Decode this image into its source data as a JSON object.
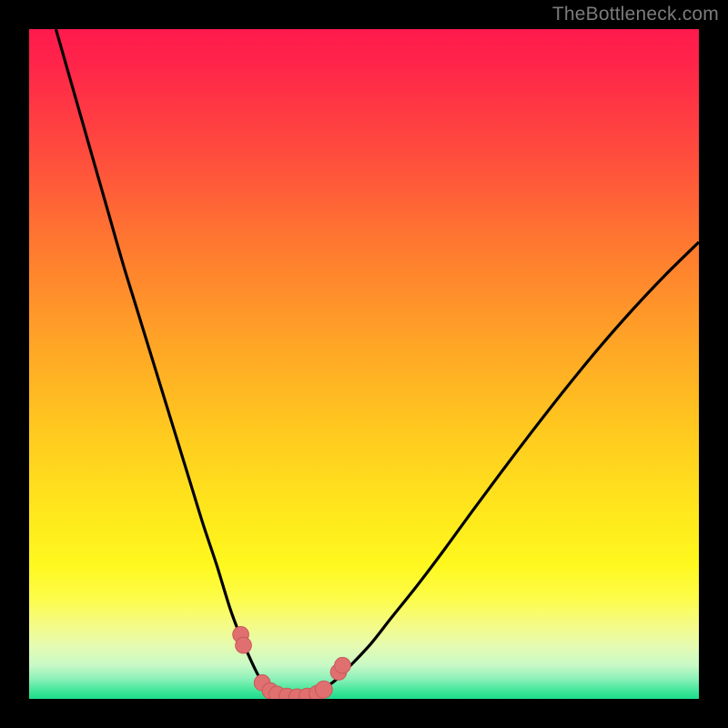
{
  "watermark": {
    "text": "TheBottleneck.com"
  },
  "chart_data": {
    "type": "line",
    "title": "",
    "xlabel": "",
    "ylabel": "",
    "xlim": [
      0,
      100
    ],
    "ylim": [
      0,
      100
    ],
    "gradient_note": "red (top) → yellow → green (bottom)",
    "curves": [
      {
        "name": "left-branch",
        "x": [
          4,
          6,
          8,
          10,
          12,
          14,
          16,
          18,
          20,
          22,
          24,
          26,
          28,
          30,
          31.5,
          33,
          34.5,
          36
        ],
        "y": [
          100,
          93,
          86,
          79,
          72,
          65,
          58.5,
          52,
          45.5,
          39,
          32.5,
          26,
          20,
          13.5,
          9.5,
          6,
          3,
          1.2
        ]
      },
      {
        "name": "valley",
        "x": [
          36,
          37,
          38,
          39,
          40,
          41,
          42,
          43,
          44
        ],
        "y": [
          1.2,
          0.6,
          0.3,
          0.2,
          0.2,
          0.25,
          0.5,
          0.9,
          1.5
        ]
      },
      {
        "name": "right-branch",
        "x": [
          44,
          46,
          48,
          51,
          54,
          58,
          62,
          66,
          70,
          75,
          80,
          85,
          90,
          95,
          100
        ],
        "y": [
          1.5,
          3.0,
          5.0,
          8.2,
          12.0,
          17.0,
          22.3,
          27.8,
          33.2,
          39.8,
          46.2,
          52.3,
          58.0,
          63.3,
          68.2
        ]
      }
    ],
    "markers": {
      "name": "highlighted-points",
      "points": [
        {
          "x": 31.6,
          "y": 9.6,
          "r": 1.6
        },
        {
          "x": 32.0,
          "y": 8.0,
          "r": 1.6
        },
        {
          "x": 34.8,
          "y": 2.4,
          "r": 1.6
        },
        {
          "x": 36.0,
          "y": 1.2,
          "r": 1.6
        },
        {
          "x": 37.0,
          "y": 0.7,
          "r": 1.6
        },
        {
          "x": 38.5,
          "y": 0.4,
          "r": 1.6
        },
        {
          "x": 40.0,
          "y": 0.3,
          "r": 1.6
        },
        {
          "x": 41.5,
          "y": 0.4,
          "r": 1.6
        },
        {
          "x": 43.0,
          "y": 0.8,
          "r": 1.6
        },
        {
          "x": 44.0,
          "y": 1.4,
          "r": 1.7
        },
        {
          "x": 46.2,
          "y": 4.0,
          "r": 1.6
        },
        {
          "x": 46.8,
          "y": 5.0,
          "r": 1.6
        }
      ]
    }
  }
}
